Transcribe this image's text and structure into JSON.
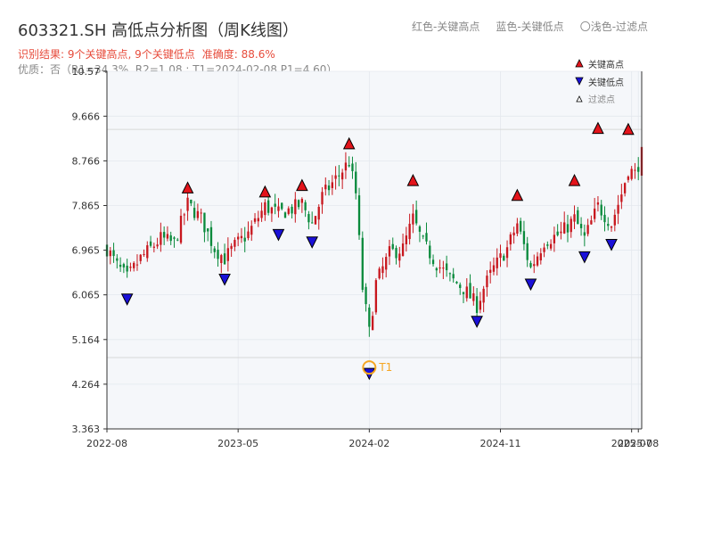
{
  "header": {
    "title": "603321.SH 高低点分析图（周K线图）",
    "result_line": "识别结果: 9个关键高点, 9个关键低点",
    "accuracy_line": "准确度: 88.6%",
    "quality_line": "优质：否（R1=34.3%, R2=1.08 ; T1=2024-02-08 P1=4.60）"
  },
  "top_legend": {
    "red": "红色-关键高点",
    "blue": "蓝色-关键低点",
    "light": "〇浅色-过滤点"
  },
  "chart_data": {
    "type": "candlestick",
    "yaxis": {
      "ticks": [
        "3.363",
        "4.264",
        "5.164",
        "6.065",
        "6.965",
        "7.865",
        "8.766",
        "9.666",
        "10.57"
      ],
      "range": [
        3.363,
        10.57
      ]
    },
    "xaxis": {
      "ticks": [
        {
          "label": "2022-08",
          "week": 0
        },
        {
          "label": "2023-05",
          "week": 39
        },
        {
          "label": "2024-02",
          "week": 78
        },
        {
          "label": "2024-11",
          "week": 117
        },
        {
          "label": "2025-07",
          "week": 156
        },
        {
          "label": "2025-08",
          "week": 158
        }
      ],
      "range": [
        0,
        159
      ]
    },
    "legend": {
      "position": "top-right",
      "items": [
        "关键高点",
        "关键低点",
        "过滤点"
      ]
    },
    "key_highs": [
      {
        "week": 24,
        "value": 8.1
      },
      {
        "week": 47,
        "value": 8.02
      },
      {
        "week": 58,
        "value": 8.15
      },
      {
        "week": 72,
        "value": 8.99
      },
      {
        "week": 91,
        "value": 8.25
      },
      {
        "week": 122,
        "value": 7.95
      },
      {
        "week": 139,
        "value": 8.25
      },
      {
        "week": 146,
        "value": 9.3
      },
      {
        "week": 155,
        "value": 9.28
      }
    ],
    "key_lows": [
      {
        "week": 6,
        "value": 6.1
      },
      {
        "week": 35,
        "value": 6.5
      },
      {
        "week": 51,
        "value": 7.4
      },
      {
        "week": 61,
        "value": 7.25
      },
      {
        "week": 78,
        "value": 4.6
      },
      {
        "week": 110,
        "value": 5.65
      },
      {
        "week": 126,
        "value": 6.4
      },
      {
        "week": 142,
        "value": 6.95
      },
      {
        "week": 150,
        "value": 7.2
      }
    ],
    "annotation": {
      "label": "T1",
      "week": 78,
      "value": 4.6
    },
    "hlines": [
      9.4,
      4.8
    ],
    "anchors": [
      {
        "w": 0,
        "p": 7.0
      },
      {
        "w": 3,
        "p": 6.65
      },
      {
        "w": 6,
        "p": 6.4
      },
      {
        "w": 10,
        "p": 6.8
      },
      {
        "w": 16,
        "p": 7.2
      },
      {
        "w": 20,
        "p": 7.1
      },
      {
        "w": 24,
        "p": 7.9
      },
      {
        "w": 28,
        "p": 7.6
      },
      {
        "w": 32,
        "p": 7.0
      },
      {
        "w": 35,
        "p": 6.8
      },
      {
        "w": 38,
        "p": 7.05
      },
      {
        "w": 42,
        "p": 7.3
      },
      {
        "w": 47,
        "p": 7.85
      },
      {
        "w": 51,
        "p": 7.7
      },
      {
        "w": 55,
        "p": 7.8
      },
      {
        "w": 58,
        "p": 7.9
      },
      {
        "w": 61,
        "p": 7.5
      },
      {
        "w": 64,
        "p": 8.05
      },
      {
        "w": 68,
        "p": 8.4
      },
      {
        "w": 72,
        "p": 8.75
      },
      {
        "w": 74,
        "p": 8.1
      },
      {
        "w": 76,
        "p": 6.2
      },
      {
        "w": 78,
        "p": 5.3
      },
      {
        "w": 80,
        "p": 6.3
      },
      {
        "w": 84,
        "p": 6.9
      },
      {
        "w": 88,
        "p": 7.0
      },
      {
        "w": 91,
        "p": 7.6
      },
      {
        "w": 94,
        "p": 7.1
      },
      {
        "w": 98,
        "p": 6.7
      },
      {
        "w": 102,
        "p": 6.4
      },
      {
        "w": 106,
        "p": 6.2
      },
      {
        "w": 110,
        "p": 5.85
      },
      {
        "w": 112,
        "p": 6.2
      },
      {
        "w": 115,
        "p": 6.6
      },
      {
        "w": 119,
        "p": 7.0
      },
      {
        "w": 122,
        "p": 7.5
      },
      {
        "w": 126,
        "p": 6.6
      },
      {
        "w": 130,
        "p": 7.15
      },
      {
        "w": 135,
        "p": 7.3
      },
      {
        "w": 139,
        "p": 7.6
      },
      {
        "w": 142,
        "p": 7.2
      },
      {
        "w": 146,
        "p": 7.85
      },
      {
        "w": 150,
        "p": 7.5
      },
      {
        "w": 153,
        "p": 8.1
      },
      {
        "w": 155,
        "p": 8.6
      },
      {
        "w": 157,
        "p": 8.5
      },
      {
        "w": 159,
        "p": 8.9
      }
    ]
  },
  "colors": {
    "up": "#c8171e",
    "down": "#0a8a3c",
    "high_marker": "#e3141b",
    "low_marker": "#1a10d8",
    "filtered_marker": "#ffffff",
    "annotation": "#f5a623",
    "plot_bg": "#f5f7fa",
    "hline": "#d8d8d8",
    "grid": "#e4e8ee"
  }
}
